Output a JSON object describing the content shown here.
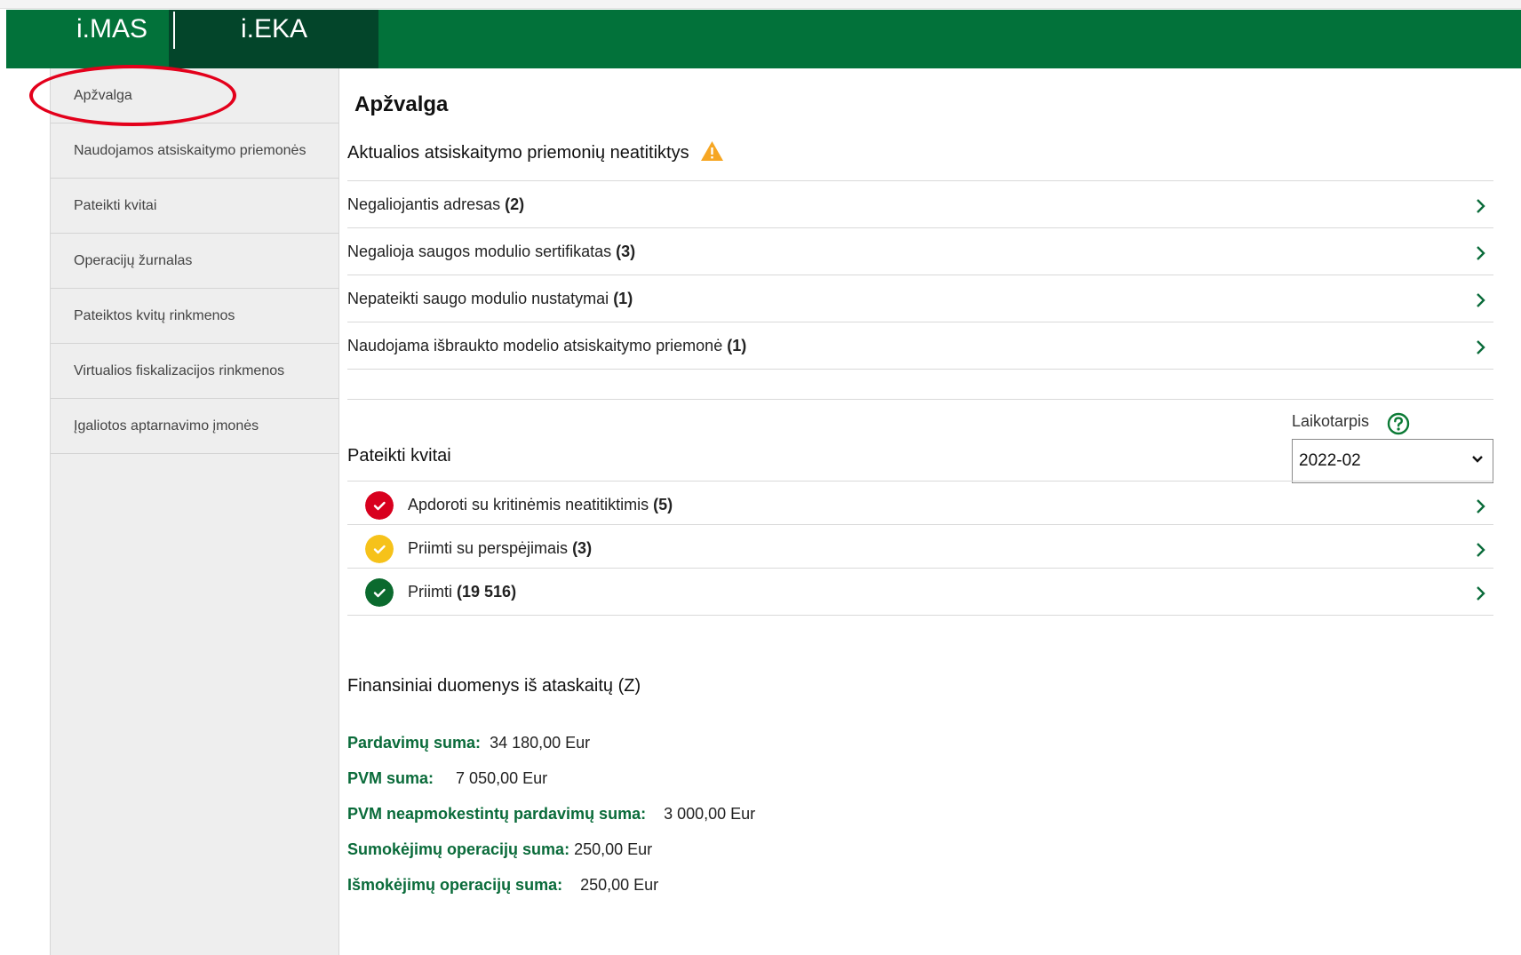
{
  "header": {
    "tabs": [
      {
        "label": "i.MAS"
      },
      {
        "label": "i.EKA"
      }
    ]
  },
  "sidebar": {
    "items": [
      {
        "label": "Apžvalga"
      },
      {
        "label": "Naudojamos atsiskaitymo priemonės"
      },
      {
        "label": "Pateikti kvitai"
      },
      {
        "label": "Operacijų žurnalas"
      },
      {
        "label": "Pateiktos kvitų rinkmenos"
      },
      {
        "label": "Virtualios fiskalizacijos rinkmenos"
      },
      {
        "label": "Įgaliotos aptarnavimo įmonės"
      }
    ]
  },
  "main": {
    "title": "Apžvalga",
    "issues_title": "Aktualios atsiskaitymo priemonių neatitiktys",
    "issues": [
      {
        "text": "Negaliojantis adresas",
        "count": "(2)"
      },
      {
        "text": "Negalioja saugos modulio sertifikatas ",
        "count": "(3)"
      },
      {
        "text": "Nepateikti saugo modulio nustatymai",
        "count": "(1)"
      },
      {
        "text": "Naudojama išbraukto modelio atsiskaitymo priemonė",
        "count": "(1)"
      }
    ],
    "period": {
      "label": "Laikotarpis",
      "value": "2022-02"
    },
    "receipts_title": "Pateikti kvitai",
    "receipts": [
      {
        "text": "Apdoroti su kritinėmis neatitiktimis",
        "count": "(5)",
        "color": "#d8001e"
      },
      {
        "text": "Priimti su perspėjimais",
        "count": "(3)",
        "color": "#f6c21a"
      },
      {
        "text": "Priimti",
        "count": "(19 516)",
        "color": "#0b6a2e"
      }
    ],
    "finance_title": "Finansiniai duomenys iš ataskaitų (Z)",
    "finance": [
      {
        "label": "Pardavimų suma:",
        "value": "34 180,00 Eur"
      },
      {
        "label": "PVM suma:",
        "value": "7 050,00 Eur"
      },
      {
        "label": "PVM neapmokestintų pardavimų suma:",
        "value": "3 000,00 Eur"
      },
      {
        "label": "Sumokėjimų operacijų suma:",
        "value": "250,00 Eur"
      },
      {
        "label": "Išmokėjimų operacijų suma:",
        "value": "250,00 Eur"
      }
    ]
  },
  "colors": {
    "brand_green": "#02723a",
    "brand_dark_green": "#03452a",
    "highlight_oval": "#e3001b",
    "warning": "#f6a623"
  }
}
